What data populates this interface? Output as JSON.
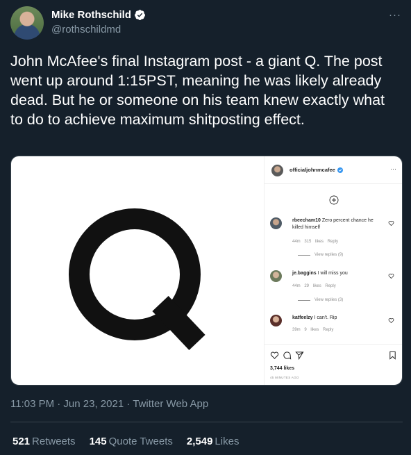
{
  "author": {
    "display_name": "Mike Rothschild",
    "handle": "@rothschildmd",
    "verified_icon": "verified-badge-icon",
    "more_icon": "more-options-icon"
  },
  "tweet": {
    "text": "John McAfee's final Instagram post - a giant Q. The post went up around 1:15PST, meaning he was likely already dead. But he or someone on his team knew exactly what to do to achieve maximum shitposting effect.",
    "timestamp": "11:03 PM · Jun 23, 2021 · Twitter Web App"
  },
  "media": {
    "q_glyph": "Q",
    "instagram": {
      "username": "officialjohnmcafee",
      "more": "···",
      "comments": [
        {
          "user": "rbeecham10",
          "text": "Zero percent chance he killed himself",
          "time": "44m",
          "likes": "315 likes",
          "reply": "Reply",
          "view_replies": "View replies (9)"
        },
        {
          "user": "je.baggins",
          "text": "I will miss you",
          "time": "44m",
          "likes": "29 likes",
          "reply": "Reply",
          "view_replies": "View replies (3)"
        },
        {
          "user": "katfeelzy",
          "text": "I can't. Rip",
          "time": "39m",
          "likes": "9 likes",
          "reply": "Reply"
        }
      ],
      "likes": "3,744 likes",
      "time_ago": "45 MINUTES AGO"
    }
  },
  "stats": {
    "retweets_count": "521",
    "retweets_label": "Retweets",
    "quotes_count": "145",
    "quotes_label": "Quote Tweets",
    "likes_count": "2,549",
    "likes_label": "Likes"
  },
  "colors": {
    "background": "#15202b",
    "verified": "#1da1f2",
    "muted": "#8899a6"
  }
}
